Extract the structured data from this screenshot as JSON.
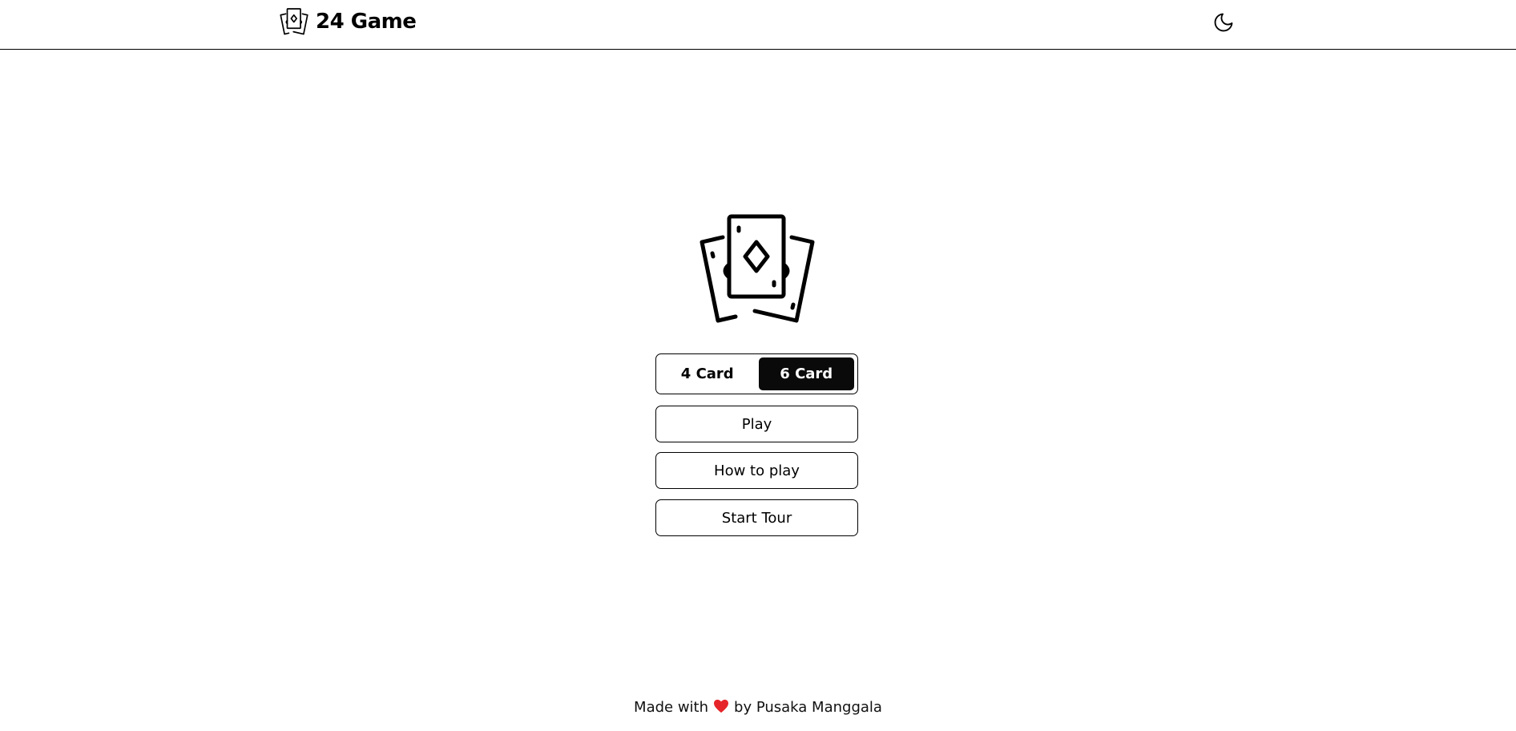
{
  "header": {
    "title": "24 Game",
    "logo_icon": "playing-cards-icon",
    "theme_toggle_icon": "moon-icon"
  },
  "hero": {
    "icon": "playing-cards-icon"
  },
  "mode_selector": {
    "options": [
      "4 Card",
      "6 Card"
    ],
    "selected": "6 Card"
  },
  "menu": {
    "play_label": "Play",
    "how_to_play_label": "How to play",
    "start_tour_label": "Start Tour"
  },
  "footer": {
    "prefix": "Made with",
    "heart_icon": "heart-icon",
    "heart_color": "#e5252a",
    "suffix": "by Pusaka Manggala"
  },
  "colors": {
    "text": "#000000",
    "background": "#ffffff",
    "active_segment": "#0a0a0a"
  }
}
